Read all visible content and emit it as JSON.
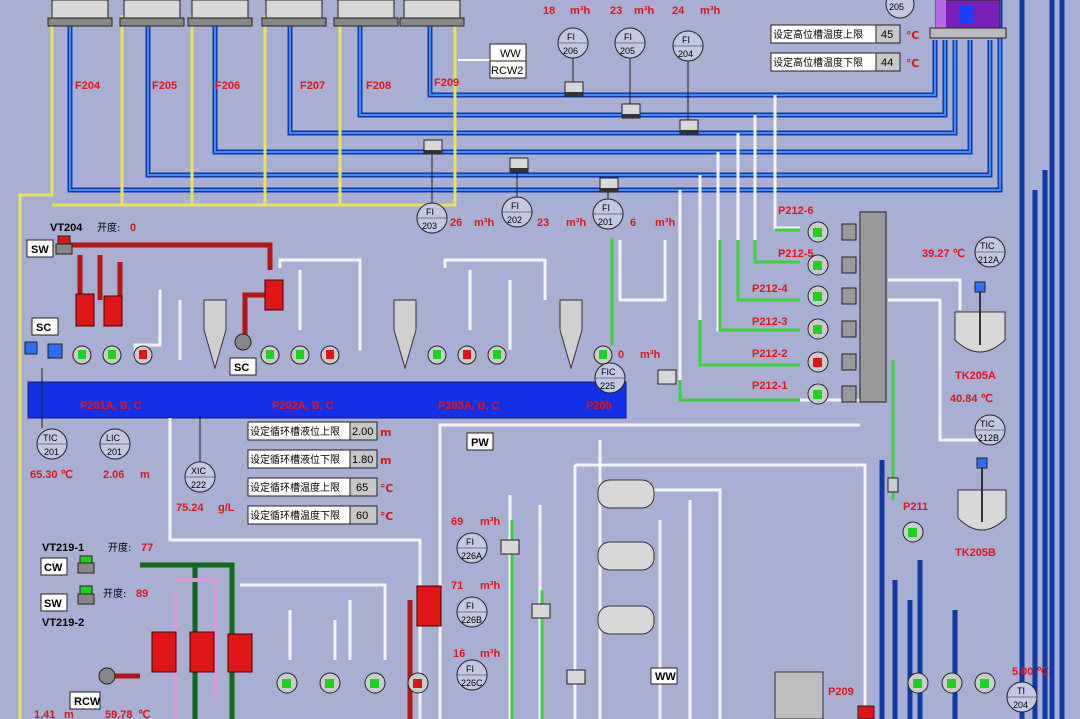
{
  "top_flow": {
    "v1": "18",
    "v2": "23",
    "v3": "24",
    "unit": "m³h"
  },
  "tanks_top": [
    "F204",
    "F205",
    "F206",
    "F207",
    "F208",
    "F209"
  ],
  "ww_box": {
    "l1": "WW",
    "l2": "RCW2"
  },
  "fi_top": [
    {
      "tag": "FI",
      "num": "206"
    },
    {
      "tag": "FI",
      "num": "205"
    },
    {
      "tag": "FI",
      "num": "204"
    }
  ],
  "fi_mid": [
    {
      "tag": "FI",
      "num": "203",
      "value": "26",
      "unit": "m³h"
    },
    {
      "tag": "FI",
      "num": "202",
      "value": "23",
      "unit": "m³h"
    },
    {
      "tag": "FI",
      "num": "201",
      "value": "6",
      "unit": "m³h"
    }
  ],
  "badge_205": "205",
  "high_tank": {
    "upper_label": "设定高位槽温度上限",
    "upper_value": "45",
    "upper_unit": "℃",
    "lower_label": "设定高位槽温度下限",
    "lower_value": "44",
    "lower_unit": "℃"
  },
  "vt204": {
    "name": "VT204",
    "open_label": "开度:",
    "open_value": "0"
  },
  "btn_sw_1": "SW",
  "btn_sc_1": "SC",
  "btn_sc_2": "SC",
  "tank_labels": {
    "a": "P201A, B, C",
    "b": "P202A, B, C",
    "c": "P203A, B, C",
    "d": "P205"
  },
  "fic225": {
    "tag": "FIC",
    "num": "225",
    "value": "0",
    "unit": "m³h"
  },
  "tic201": {
    "tag": "TIC",
    "num": "201",
    "value": "65.30 ℃"
  },
  "lic201": {
    "tag": "LIC",
    "num": "201",
    "value": "2.06",
    "unit": "m"
  },
  "xic222": {
    "tag": "XIC",
    "num": "222",
    "value": "75.24",
    "unit": "g/L"
  },
  "circ_settings": [
    {
      "label": "设定循环槽液位上限",
      "value": "2.00",
      "unit": "m"
    },
    {
      "label": "设定循环槽液位下限",
      "value": "1.80",
      "unit": "m"
    },
    {
      "label": "设定循环槽温度上限",
      "value": "65",
      "unit": "℃"
    },
    {
      "label": "设定循环槽温度下限",
      "value": "60",
      "unit": "℃"
    }
  ],
  "pumps_p212": [
    "P212-6",
    "P212-5",
    "P212-4",
    "P212-3",
    "P212-2",
    "P212-1"
  ],
  "tic212a": {
    "tag": "TIC",
    "num": "212A",
    "value": "39.27 ℃"
  },
  "tk205a": "TK205A",
  "tic212b": {
    "tag": "TIC",
    "num": "212B",
    "value": "40.84 ℃"
  },
  "tk205b": "TK205B",
  "p211": "P211",
  "pw": "PW",
  "fi226": [
    {
      "tag": "FI",
      "num": "226A",
      "value": "69",
      "unit": "m³h"
    },
    {
      "tag": "FI",
      "num": "226B",
      "value": "71",
      "unit": "m³h"
    },
    {
      "tag": "FI",
      "num": "226C",
      "value": "16",
      "unit": "m³h"
    }
  ],
  "vt219_1": {
    "name": "VT219-1",
    "open_label": "开度:",
    "open_value": "77",
    "btn": "CW"
  },
  "vt219_2": {
    "name": "VT219-2",
    "open_label": "开度:",
    "open_value": "89",
    "btn": "SW"
  },
  "rcw": "RCW",
  "bottom_vals": {
    "a": "1.41",
    "a_unit": "m",
    "b": "59.78",
    "b_unit": "℃"
  },
  "ww_bottom": "WW",
  "p209": "P209",
  "ti204": {
    "tag": "TI",
    "num": "204",
    "value": "5.00 ℃"
  },
  "colors": {
    "background": "#a9aed3",
    "tank_blue": "#1430e6",
    "alarm_red": "#e01616",
    "pipe_blue": "#0f3aa5",
    "pipe_green": "#3bd23b"
  }
}
